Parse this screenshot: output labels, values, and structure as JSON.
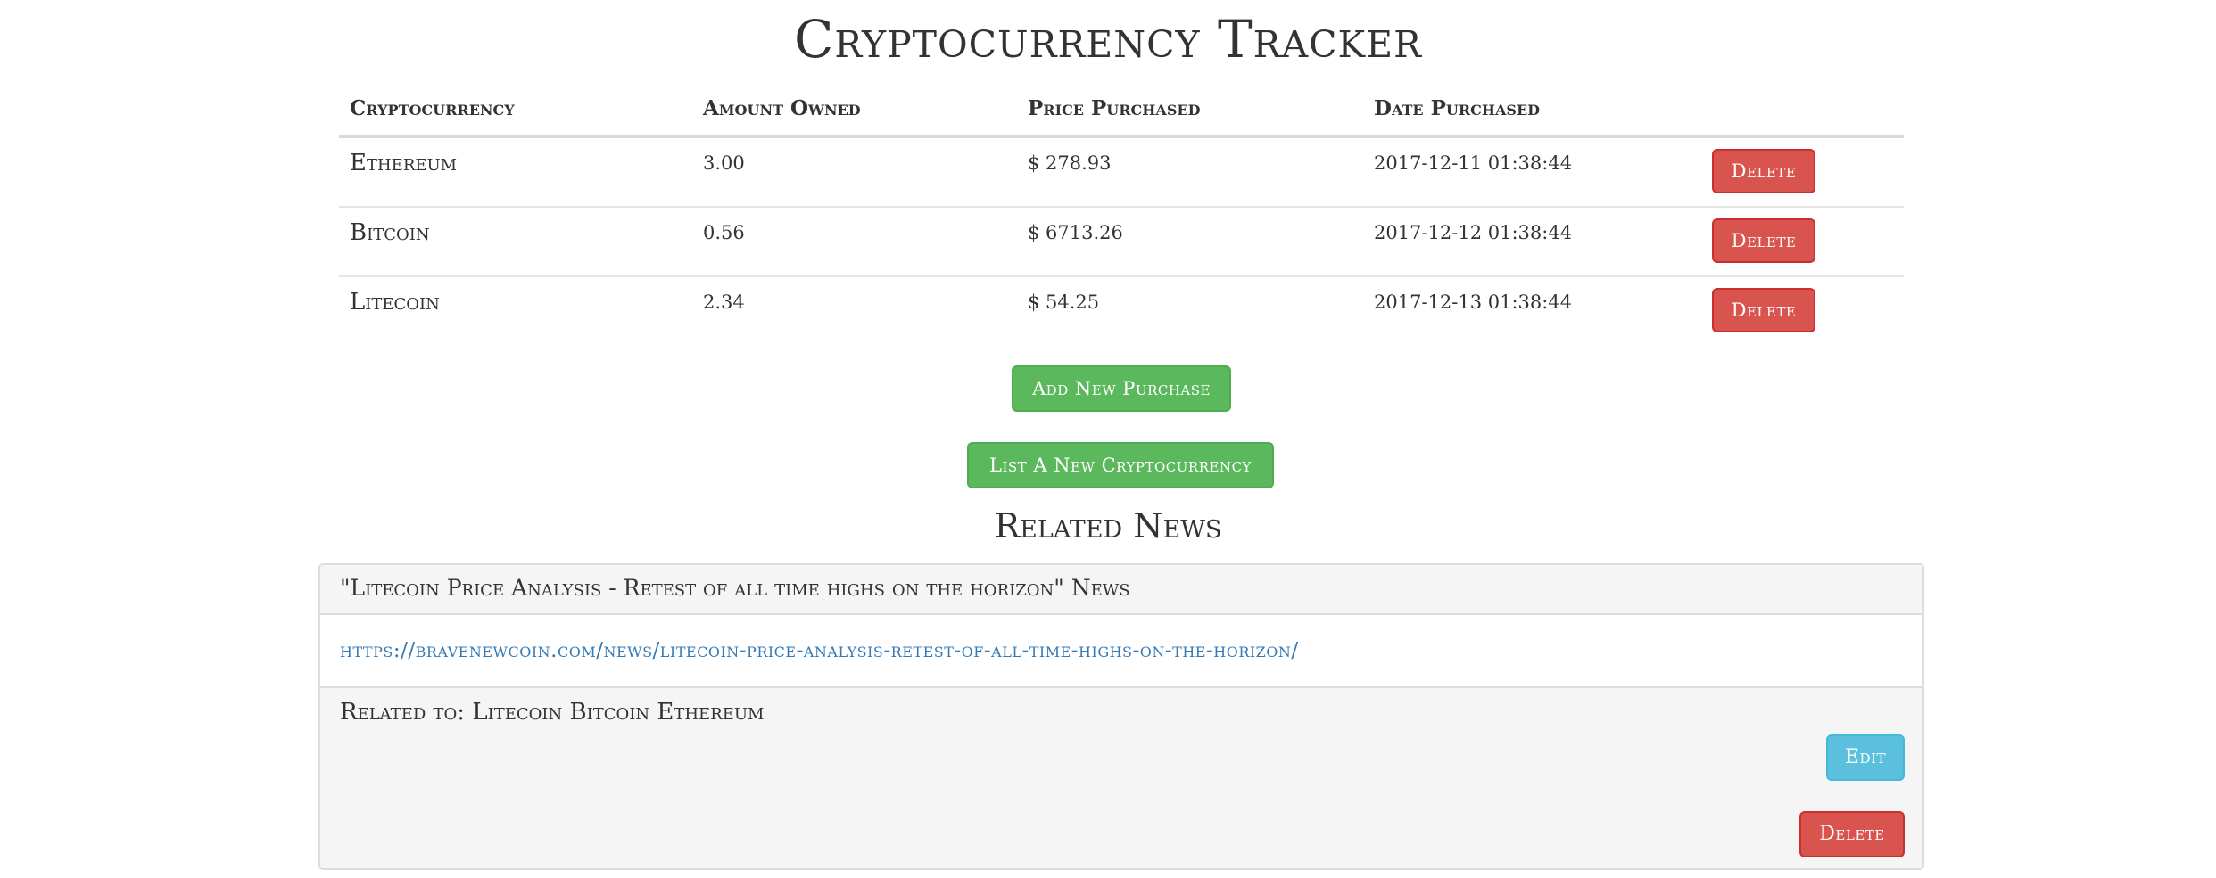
{
  "title": "Cryptocurrency Tracker",
  "table": {
    "headers": [
      "Cryptocurrency",
      "Amount Owned",
      "Price Purchased",
      "Date Purchased"
    ],
    "rows": [
      {
        "name": "Ethereum",
        "amount": "3.00",
        "price": "$ 278.93",
        "date": "2017-12-11 01:38:44",
        "delete_label": "Delete"
      },
      {
        "name": "Bitcoin",
        "amount": "0.56",
        "price": "$ 6713.26",
        "date": "2017-12-12 01:38:44",
        "delete_label": "Delete"
      },
      {
        "name": "Litecoin",
        "amount": "2.34",
        "price": "$ 54.25",
        "date": "2017-12-13 01:38:44",
        "delete_label": "Delete"
      }
    ]
  },
  "actions": {
    "add_purchase_label": "Add New Purchase",
    "list_crypto_label": "List A New Cryptocurrency"
  },
  "news": {
    "heading": "Related News",
    "items": [
      {
        "title": "\"Litecoin Price Analysis - Retest of all time highs on the horizon\" News",
        "url": "https://bravenewcoin.com/news/litecoin-price-analysis-retest-of-all-time-highs-on-the-horizon/",
        "related": "Related to: Litecoin Bitcoin Ethereum",
        "edit_label": "Edit",
        "delete_label": "Delete"
      }
    ]
  },
  "colors": {
    "danger": "#d9534f",
    "success": "#5cb85c",
    "info": "#5bc0de",
    "link": "#337ab7"
  }
}
